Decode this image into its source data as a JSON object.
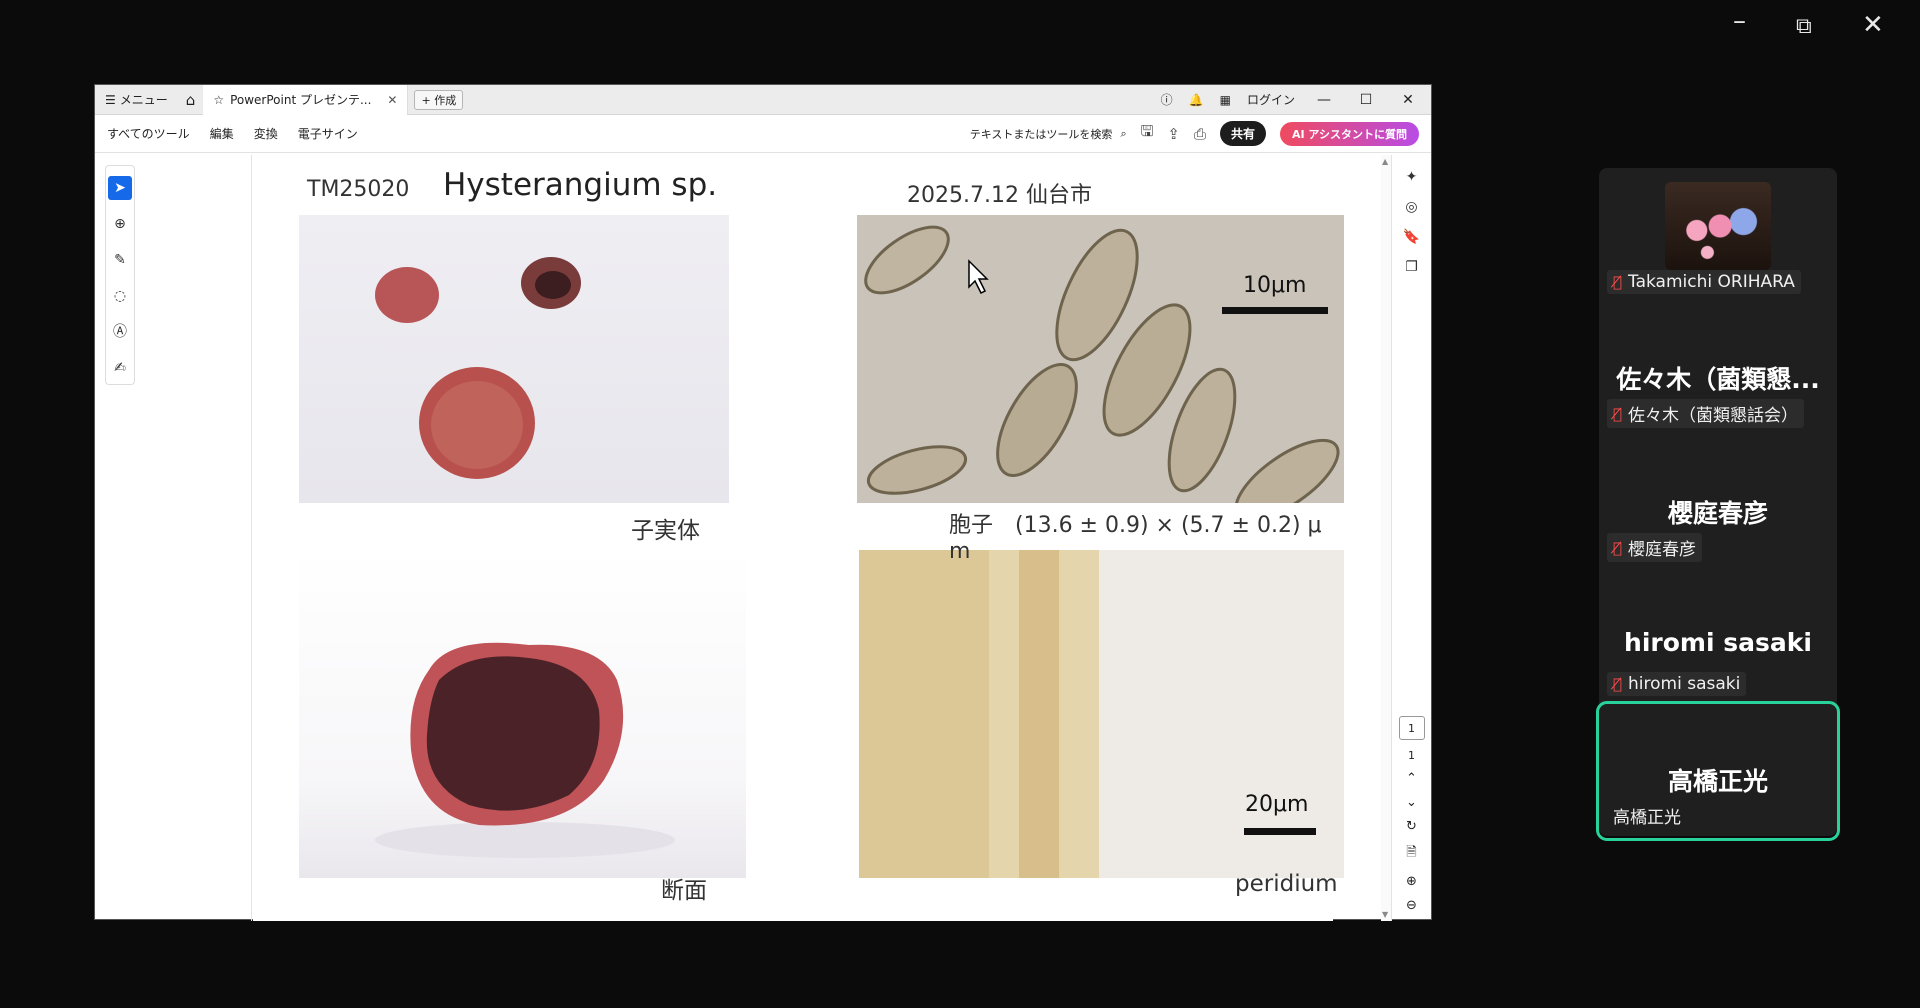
{
  "outer_window": {
    "min": "–",
    "restore": "⧉",
    "close": "✕"
  },
  "tabbar": {
    "menu_label": "メニュー",
    "tab_title": "PowerPoint プレゼンテ...",
    "new_tab_label": "作成",
    "login_label": "ログイン"
  },
  "toolbar": {
    "items": [
      "すべてのツール",
      "編集",
      "変換",
      "電子サイン"
    ],
    "search_label": "テキストまたはツールを検索",
    "share_label": "共有",
    "ai_label": "AI アシスタントに質問"
  },
  "slide": {
    "specimen_id": "TM25020",
    "title": "Hysterangium sp.",
    "date_place": "2025.7.12 仙台市",
    "captions": {
      "fruitbody": "子実体",
      "spore": "胞子　(13.6 ± 0.9) × (5.7 ± 0.2) μ m",
      "section": "断面",
      "peridium": "peridium"
    },
    "scale_bars": {
      "spore": "10μm",
      "peridium": "20μm"
    }
  },
  "page_nav": {
    "current": "1",
    "total": "1"
  },
  "participants": [
    {
      "big": "",
      "label": "Takamichi ORIHARA",
      "muted": true,
      "avatar": true
    },
    {
      "big": "佐々木（菌類懇...",
      "label": "佐々木（菌類懇話会）",
      "muted": true
    },
    {
      "big": "櫻庭春彦",
      "label": "櫻庭春彦",
      "muted": true
    },
    {
      "big": "hiromi sasaki",
      "label": "hiromi sasaki",
      "muted": true
    },
    {
      "big": "高橋正光",
      "label": "高橋正光",
      "muted": false,
      "active": true
    }
  ],
  "colors": {
    "active_speaker": "#28d29a",
    "mute": "#ff4b4b",
    "select_tool": "#1669e8"
  }
}
